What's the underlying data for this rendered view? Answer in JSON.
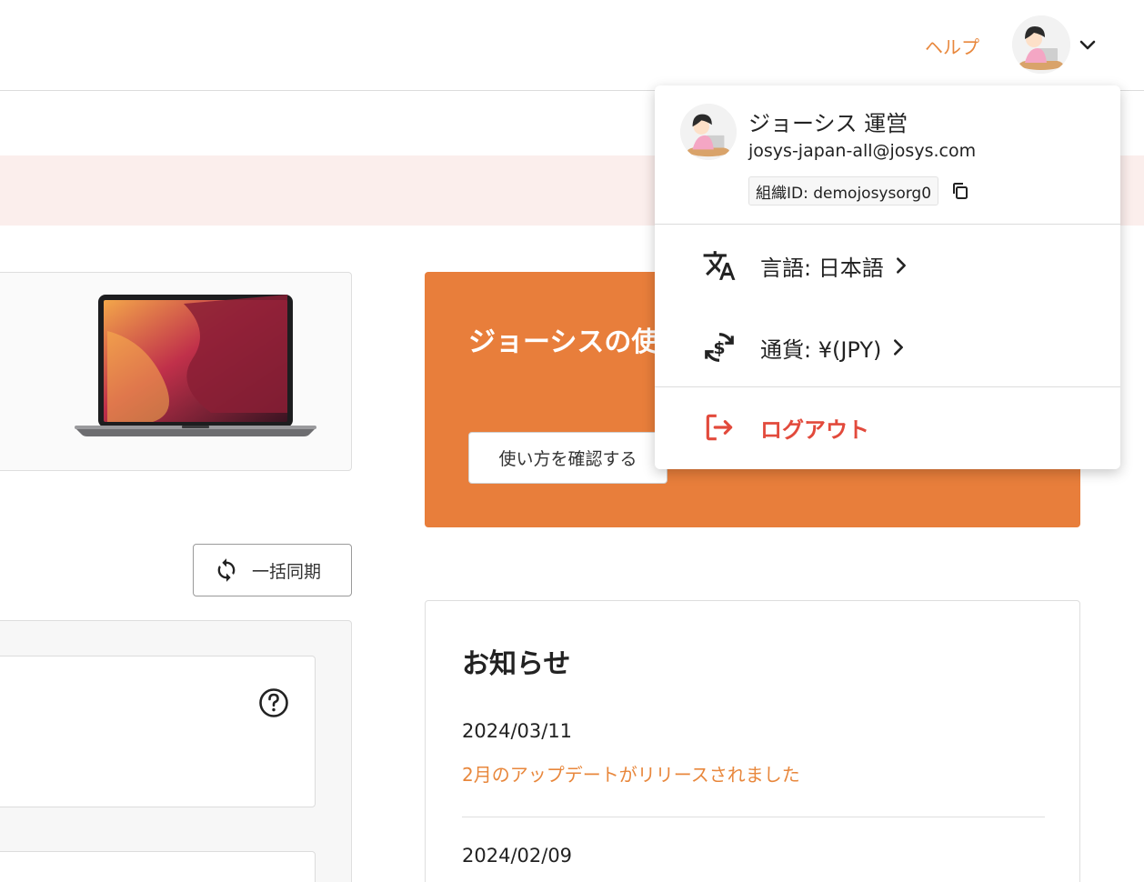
{
  "header": {
    "help_label": "ヘルプ",
    "avatar_icon": "user-avatar-icon",
    "menu_chevron_icon": "chevron-down-icon"
  },
  "promo": {
    "title": "ジョーシスの使",
    "button_label": "使い方を確認する",
    "background_color": "#e87e3b"
  },
  "sync": {
    "button_label": "一括同期",
    "icon": "sync-icon"
  },
  "news": {
    "title": "お知らせ",
    "items": [
      {
        "date": "2024/03/11",
        "title": "2月のアップデートがリリースされました"
      },
      {
        "date": "2024/02/09",
        "title": ""
      }
    ]
  },
  "dropdown": {
    "user_name": "ジョーシス 運営",
    "email": "josys-japan-all@josys.com",
    "org_id": "組織ID: demojosysorg0",
    "copy_icon": "copy-icon",
    "language_label": "言語: 日本語",
    "language_icon": "translate-icon",
    "currency_label": "通貨: ¥(JPY)",
    "currency_icon": "currency-exchange-icon",
    "logout_label": "ログアウト",
    "logout_icon": "logout-icon",
    "logout_color": "#e24a3c"
  },
  "colors": {
    "accent": "#e8873c",
    "notice_background": "#fbeeec"
  }
}
